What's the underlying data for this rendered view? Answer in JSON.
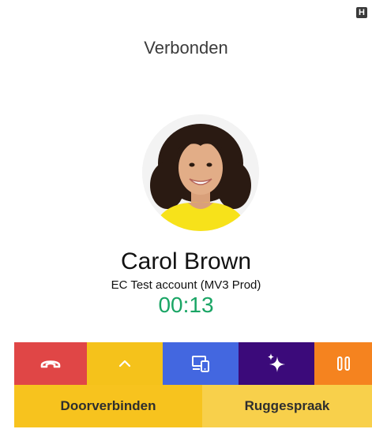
{
  "header": {
    "badge": "H",
    "status": "Verbonden"
  },
  "contact": {
    "name": "Carol Brown",
    "account": "EC Test account (MV3 Prod)",
    "duration": "00:13"
  },
  "actions": [
    {
      "icon": "hang-up-icon",
      "color": "#e04646"
    },
    {
      "icon": "chevron-up-icon",
      "color": "#f5c21b"
    },
    {
      "icon": "devices-icon",
      "color": "#4367e0"
    },
    {
      "icon": "sparkle-icon",
      "color": "#3b0a7a"
    },
    {
      "icon": "pause-icon",
      "color": "#f5831f"
    }
  ],
  "buttons": {
    "transfer": "Doorverbinden",
    "consult": "Ruggespraak"
  },
  "colors": {
    "timer": "#1aa565",
    "transfer_bg": "#f7c31e",
    "consult_bg": "#f8d04b"
  }
}
